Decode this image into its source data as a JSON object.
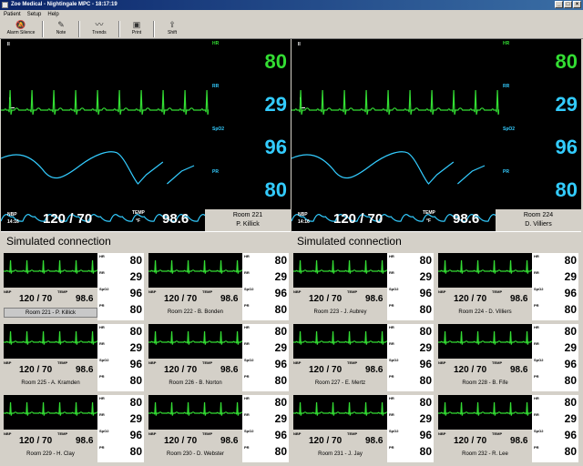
{
  "window": {
    "title": "Zoe Medical - Nightingale MPC - 18:17:19"
  },
  "menu": [
    "Patient",
    "Setup",
    "Help"
  ],
  "toolbar": [
    {
      "label": "Alarm Silence",
      "icon": "bell-off-icon"
    },
    {
      "label": "Note",
      "icon": "pencil-icon"
    },
    {
      "label": "Trends",
      "icon": "trend-chart-icon"
    },
    {
      "label": "Print",
      "icon": "printer-icon"
    },
    {
      "label": "Shift",
      "icon": "shift-arrow-icon"
    }
  ],
  "colors": {
    "hr": "#33dd33",
    "rr": "#33ccff",
    "spo2": "#33ccff",
    "pr": "#33ccff",
    "screen": "#000000",
    "tile_ecg": "#33dd33"
  },
  "labels": {
    "lead": "II",
    "hr": "HR",
    "rr": "RR",
    "spo2": "SpO2",
    "pr": "PR",
    "nbp": "NBP",
    "temp": "TEMP",
    "temp_unit": "°F"
  },
  "large_panels": [
    {
      "lead": "II",
      "hr": "80",
      "rr": "29",
      "spo2": "96",
      "pr": "80",
      "nbp": "120 / 70",
      "nbp_time": "14:16",
      "temp": "98.6",
      "room": "Room 221",
      "patient": "P. Killick",
      "connection": "Simulated connection"
    },
    {
      "lead": "II",
      "hr": "80",
      "rr": "29",
      "spo2": "96",
      "pr": "80",
      "nbp": "120 / 70",
      "nbp_time": "14:16",
      "temp": "98.6",
      "room": "Room 224",
      "patient": "D. Villiers",
      "connection": "Simulated connection"
    }
  ],
  "tiles": [
    {
      "hr": "80",
      "rr": "29",
      "spo2": "96",
      "pr": "80",
      "nbp": "120 / 70",
      "temp": "98.6",
      "room": "Room 221 - P. Killick",
      "selected": true
    },
    {
      "hr": "80",
      "rr": "29",
      "spo2": "96",
      "pr": "80",
      "nbp": "120 / 70",
      "temp": "98.6",
      "room": "Room 222 - B. Bonden",
      "selected": false
    },
    {
      "hr": "80",
      "rr": "29",
      "spo2": "96",
      "pr": "80",
      "nbp": "120 / 70",
      "temp": "98.6",
      "room": "Room 223 - J. Aubrey",
      "selected": false
    },
    {
      "hr": "80",
      "rr": "29",
      "spo2": "96",
      "pr": "80",
      "nbp": "120 / 70",
      "temp": "98.6",
      "room": "Room 224 - D. Villiers",
      "selected": false
    },
    {
      "hr": "80",
      "rr": "29",
      "spo2": "96",
      "pr": "80",
      "nbp": "120 / 70",
      "temp": "98.6",
      "room": "Room 225 - A. Kramden",
      "selected": false
    },
    {
      "hr": "80",
      "rr": "29",
      "spo2": "96",
      "pr": "80",
      "nbp": "120 / 70",
      "temp": "98.6",
      "room": "Room 226 - B. Norton",
      "selected": false
    },
    {
      "hr": "80",
      "rr": "29",
      "spo2": "96",
      "pr": "80",
      "nbp": "120 / 70",
      "temp": "98.6",
      "room": "Room 227 - E. Mertz",
      "selected": false
    },
    {
      "hr": "80",
      "rr": "29",
      "spo2": "96",
      "pr": "80",
      "nbp": "120 / 70",
      "temp": "98.6",
      "room": "Room 228 - B. Fife",
      "selected": false
    },
    {
      "hr": "80",
      "rr": "29",
      "spo2": "96",
      "pr": "80",
      "nbp": "120 / 70",
      "temp": "98.6",
      "room": "Room 229 - H. Clay",
      "selected": false
    },
    {
      "hr": "80",
      "rr": "29",
      "spo2": "96",
      "pr": "80",
      "nbp": "120 / 70",
      "temp": "98.6",
      "room": "Room 230 - D. Webster",
      "selected": false
    },
    {
      "hr": "80",
      "rr": "29",
      "spo2": "96",
      "pr": "80",
      "nbp": "120 / 70",
      "temp": "98.6",
      "room": "Room 231 - J. Jay",
      "selected": false
    },
    {
      "hr": "80",
      "rr": "29",
      "spo2": "96",
      "pr": "80",
      "nbp": "120 / 70",
      "temp": "98.6",
      "room": "Room 232 - R. Lee",
      "selected": false
    }
  ]
}
